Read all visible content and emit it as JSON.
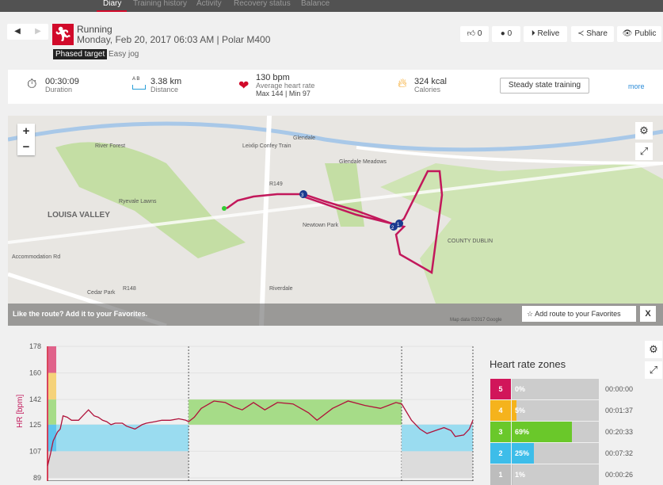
{
  "nav": {
    "tabs": [
      "Diary",
      "Training history",
      "Activity",
      "Recovery status",
      "Balance"
    ],
    "active": "Diary"
  },
  "session": {
    "sport": "Running",
    "datetime": "Monday, Feb 20, 2017 06:03 AM | Polar M400",
    "phase_label": "Phased target",
    "phase_name": "Easy jog"
  },
  "actions": {
    "likes": "0",
    "comments": "0",
    "relive": "Relive",
    "share": "Share",
    "public": "Public"
  },
  "stats": {
    "duration": "00:30:09",
    "duration_label": "Duration",
    "distance": "3.38 km",
    "distance_label": "Distance",
    "ab": "A  B",
    "hr": "130 bpm",
    "hr_label": "Average heart rate",
    "hr_maxmin": "Max 144  |  Min 97",
    "calories": "324 kcal",
    "calories_label": "Calories",
    "benefit": "Steady state training",
    "more": "more"
  },
  "map": {
    "labels": [
      "River Forest",
      "LOUISA VALLEY",
      "Leixlip Confey Train",
      "Glendale",
      "Glendale Meadows",
      "R149",
      "R148",
      "Newtown Park",
      "COUNTY DUBLIN",
      "Ryevale Lawns",
      "Cedar Park",
      "Accommodation Rd",
      "Riverdale"
    ],
    "markers": [
      "3",
      "2",
      "1"
    ],
    "favorite_msg": "Like the route?  Add it to your Favorites.",
    "favorite_btn": "Add route to your Favorites",
    "close": "X",
    "credit": "Map data ©2017 Google",
    "zoom_in": "+",
    "zoom_out": "−"
  },
  "chart_data": {
    "type": "line",
    "ylabel": "HR [bpm]",
    "yticks": [
      178,
      160,
      142,
      125,
      107,
      89
    ],
    "ylim": [
      89,
      178
    ],
    "xlim": [
      0,
      30.15
    ],
    "x_unit": "min",
    "phases": [
      {
        "start": 0,
        "end": 10.0,
        "low": 107,
        "high": 125
      },
      {
        "start": 10.0,
        "end": 25.1,
        "low": 125,
        "high": 142
      },
      {
        "start": 25.1,
        "end": 30.15,
        "low": 107,
        "high": 125
      }
    ],
    "zone_bands": [
      {
        "low": 160,
        "high": 178,
        "color": "#e0628a"
      },
      {
        "low": 142,
        "high": 160,
        "color": "#f5d27a"
      },
      {
        "low": 125,
        "high": 142,
        "color": "#a6dc88"
      },
      {
        "low": 107,
        "high": 125,
        "color": "#5ec4ee"
      }
    ],
    "x": [
      0,
      0.2,
      0.4,
      0.7,
      0.9,
      1.1,
      1.4,
      1.7,
      2.2,
      2.5,
      2.9,
      3.3,
      3.6,
      3.9,
      4.2,
      4.5,
      4.8,
      5.3,
      5.6,
      6.2,
      6.7,
      7.0,
      7.6,
      8.1,
      8.7,
      9.3,
      9.8,
      10.0,
      10.4,
      10.9,
      11.8,
      12.6,
      13.2,
      13.8,
      14.6,
      15.4,
      16.3,
      17.4,
      18.5,
      19.1,
      20.2,
      21.3,
      22.5,
      23.6,
      24.7,
      25.1,
      25.8,
      26.4,
      26.9,
      27.5,
      28.1,
      28.6,
      28.9,
      29.5,
      29.9,
      30.15
    ],
    "y": [
      97,
      105,
      114,
      120,
      122,
      131,
      130,
      128,
      128,
      131,
      135,
      131,
      130,
      128,
      127,
      125,
      126,
      126,
      124,
      122,
      125,
      126,
      127,
      128,
      128,
      129,
      128,
      127,
      130,
      136,
      141,
      140,
      137,
      135,
      140,
      135,
      140,
      139,
      133,
      128,
      136,
      141,
      138,
      136,
      140,
      139,
      128,
      122,
      119,
      121,
      123,
      121,
      117,
      118,
      122,
      128
    ]
  },
  "zones": {
    "title": "Heart rate zones",
    "rows": [
      {
        "zone": "5",
        "pct": "0%",
        "value": 0,
        "time": "00:00:00",
        "color": "#d1155a"
      },
      {
        "zone": "4",
        "pct": "5%",
        "value": 5,
        "time": "00:01:37",
        "color": "#f5b31c"
      },
      {
        "zone": "3",
        "pct": "69%",
        "value": 69,
        "time": "00:20:33",
        "color": "#6ac82a"
      },
      {
        "zone": "2",
        "pct": "25%",
        "value": 25,
        "time": "00:07:32",
        "color": "#3dbde9"
      },
      {
        "zone": "1",
        "pct": "1%",
        "value": 1,
        "time": "00:00:26",
        "color": "#bdbdbd"
      }
    ]
  }
}
